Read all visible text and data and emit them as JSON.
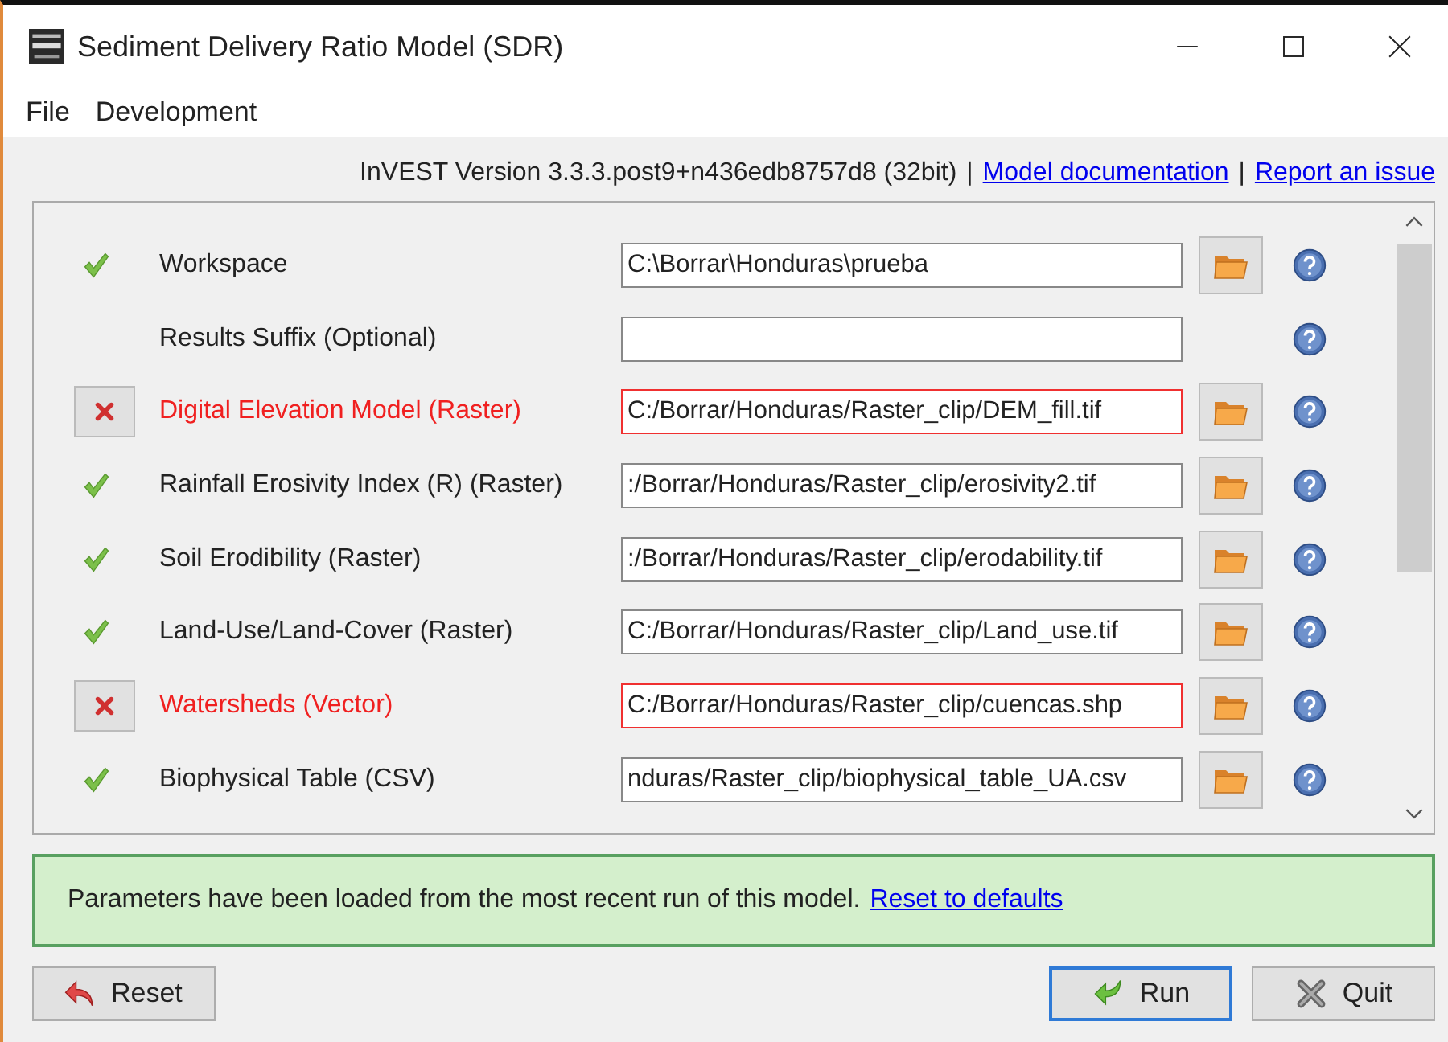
{
  "window": {
    "title": "Sediment Delivery Ratio Model (SDR)"
  },
  "menu": [
    "File",
    "Development"
  ],
  "version_line": {
    "text": "InVEST Version 3.3.3.post9+n436edb8757d8 (32bit)",
    "links": [
      {
        "separator": "|",
        "label": "Model documentation"
      },
      {
        "separator": "|",
        "label": "Report an issue"
      }
    ]
  },
  "rows": [
    {
      "label": "Workspace",
      "kind": "ok",
      "value": "C:\\Borrar\\Honduras\\prueba",
      "browse": true
    },
    {
      "label": "Results Suffix (Optional)",
      "kind": "none",
      "browse": false
    },
    {
      "label": "Digital Elevation Model (Raster)",
      "kind": "error",
      "value": "C:/Borrar/Honduras/Raster_clip/DEM_fill.tif",
      "browse": true
    },
    {
      "label": "Rainfall Erosivity Index (R) (Raster)",
      "kind": "ok",
      "value": ":/Borrar/Honduras/Raster_clip/erosivity2.tif",
      "browse": true
    },
    {
      "label": "Soil Erodibility (Raster)",
      "kind": "ok",
      "value": ":/Borrar/Honduras/Raster_clip/erodability.tif",
      "browse": true
    },
    {
      "label": "Land-Use/Land-Cover (Raster)",
      "kind": "ok",
      "value": "C:/Borrar/Honduras/Raster_clip/Land_use.tif",
      "browse": true
    },
    {
      "label": "Watersheds (Vector)",
      "kind": "error",
      "value": "C:/Borrar/Honduras/Raster_clip/cuencas.shp",
      "browse": true
    },
    {
      "label": "Biophysical Table (CSV)",
      "kind": "ok",
      "value": "nduras/Raster_clip/biophysical_table_UA.csv",
      "browse": true
    }
  ],
  "message": {
    "text": "Parameters have been loaded from the most recent run of this model.",
    "link": "Reset to defaults"
  },
  "buttons": [
    {
      "label": "Reset",
      "kind": "reset"
    },
    {
      "label": "Run",
      "kind": "run",
      "selected": true
    },
    {
      "label": "Quit",
      "kind": "quit",
      "selected": false
    }
  ]
}
